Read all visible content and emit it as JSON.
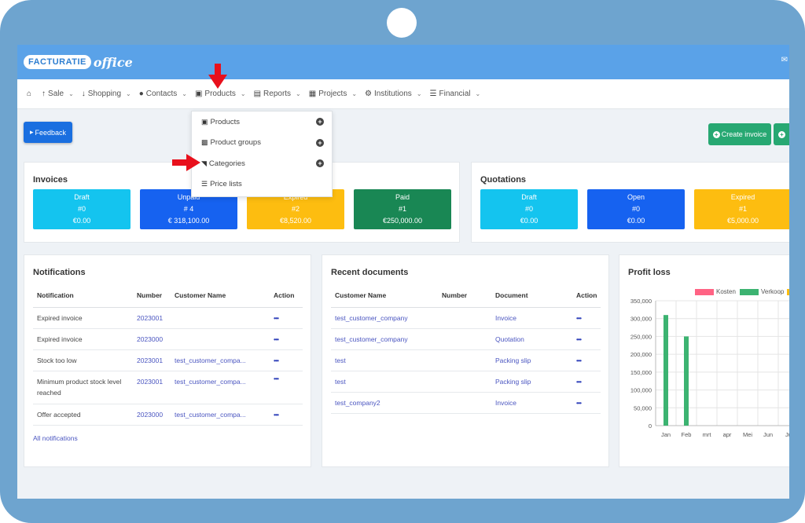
{
  "brand": {
    "logo_box": "FACTURATIE",
    "logo_script": "office"
  },
  "nav": {
    "items": [
      {
        "label": "Sale"
      },
      {
        "label": "Shopping"
      },
      {
        "label": "Contacts"
      },
      {
        "label": "Products"
      },
      {
        "label": "Reports"
      },
      {
        "label": "Projects"
      },
      {
        "label": "Institutions"
      },
      {
        "label": "Financial"
      }
    ]
  },
  "dropdown": {
    "items": [
      {
        "label": "Products",
        "icon": "cart-icon"
      },
      {
        "label": "Product groups",
        "icon": "box-icon"
      },
      {
        "label": "Categories",
        "icon": "folder-open-icon"
      },
      {
        "label": "Price lists",
        "icon": "list-icon"
      }
    ]
  },
  "buttons": {
    "feedback": "Feedback",
    "create_invoice": "Create invoice"
  },
  "invoices": {
    "title": "Invoices",
    "stats": [
      {
        "label": "Draft",
        "count": "#0",
        "amount": "€0.00",
        "color": "#14c4ef"
      },
      {
        "label": "Unpaid",
        "count": "# 4",
        "amount": "€ 318,100.00",
        "color": "#1662f0"
      },
      {
        "label": "Expired",
        "count": "#2",
        "amount": "€8,520.00",
        "color": "#fdbd10"
      },
      {
        "label": "Paid",
        "count": "#1",
        "amount": "€250,000.00",
        "color": "#198754"
      }
    ]
  },
  "quotations": {
    "title": "Quotations",
    "stats": [
      {
        "label": "Draft",
        "count": "#0",
        "amount": "€0.00",
        "color": "#14c4ef"
      },
      {
        "label": "Open",
        "count": "#0",
        "amount": "€0.00",
        "color": "#1662f0"
      },
      {
        "label": "Expired",
        "count": "#1",
        "amount": "€5,000.00",
        "color": "#fdbd10"
      }
    ]
  },
  "notifications": {
    "title": "Notifications",
    "headers": [
      "Notification",
      "Number",
      "Customer Name",
      "Action"
    ],
    "rows": [
      {
        "notification": "Expired invoice",
        "number": "2023001",
        "customer": ""
      },
      {
        "notification": "Expired invoice",
        "number": "2023000",
        "customer": ""
      },
      {
        "notification": "Stock too low",
        "number": "2023001",
        "customer": "test_customer_compa..."
      },
      {
        "notification": "Minimum product stock level reached",
        "number": "2023001",
        "customer": "test_customer_compa..."
      },
      {
        "notification": "Offer accepted",
        "number": "2023000",
        "customer": "test_customer_compa..."
      }
    ],
    "action": "•••",
    "all_link": "All notifications"
  },
  "recent": {
    "title": "Recent documents",
    "headers": [
      "Customer Name",
      "Number",
      "Document",
      "Action"
    ],
    "rows": [
      {
        "customer": "test_customer_company",
        "number": "",
        "document": "Invoice"
      },
      {
        "customer": "test_customer_company",
        "number": "",
        "document": "Quotation"
      },
      {
        "customer": "test",
        "number": "",
        "document": "Packing slip"
      },
      {
        "customer": "test",
        "number": "",
        "document": "Packing slip"
      },
      {
        "customer": "test_company2",
        "number": "",
        "document": "Invoice"
      }
    ],
    "action": "•••"
  },
  "chart_data": {
    "type": "bar",
    "title": "Profit loss",
    "categories": [
      "Jan",
      "Feb",
      "mrt",
      "apr",
      "Mei",
      "Jun",
      "Ju"
    ],
    "series": [
      {
        "name": "Kosten",
        "color": "#ff6384",
        "values": [
          0,
          0,
          0,
          0,
          0,
          0,
          0
        ]
      },
      {
        "name": "Verkoop",
        "color": "#3cb371",
        "values": [
          310000,
          250000,
          0,
          0,
          0,
          0,
          0
        ]
      }
    ],
    "yticks": [
      "350,000",
      "300,000",
      "250,000",
      "200,000",
      "150,000",
      "100,000",
      "50,000",
      "0"
    ],
    "ylim": [
      0,
      350000
    ],
    "grid": true,
    "legend": "top"
  }
}
